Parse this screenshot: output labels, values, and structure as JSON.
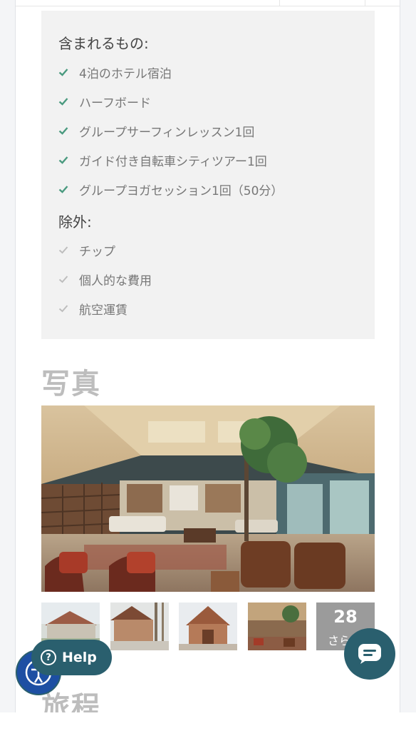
{
  "included": {
    "title": "含まれるもの:",
    "items": [
      "4泊のホテル宿泊",
      "ハーフボード",
      "グループサーフィンレッスン1回",
      "ガイド付き自転車シティツアー1回",
      "グループヨガセッション1回（50分）"
    ]
  },
  "excluded": {
    "title": "除外:",
    "items": [
      "チップ",
      "個人的な費用",
      "航空運賃"
    ]
  },
  "photos": {
    "heading": "写真",
    "more_count": "28",
    "more_label": "さら"
  },
  "itinerary": {
    "heading": "旅程"
  },
  "help": {
    "label": "Help",
    "icon": "question-circle-icon"
  },
  "colors": {
    "accent": "#2a5f6e",
    "check_included": "#4a9a7f",
    "check_excluded": "#bdbdbd",
    "card_bg": "#f2f2f2",
    "heading": "#bdbdbd"
  }
}
